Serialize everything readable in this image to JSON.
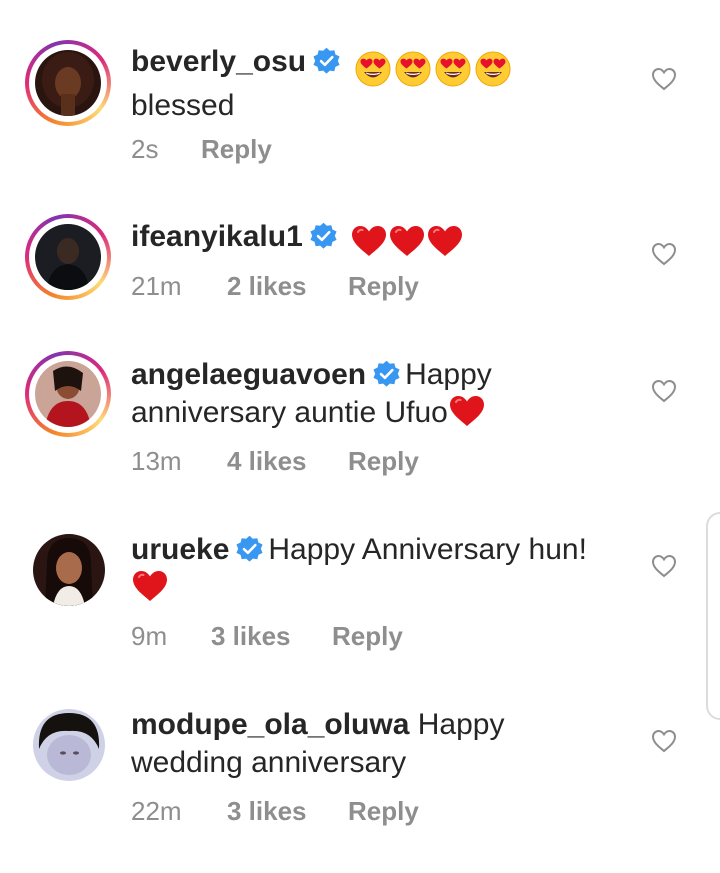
{
  "colors": {
    "text": "#262626",
    "meta": "#8e8e8e",
    "verified_badge": "#3897f0",
    "heart_red": "#e0151b"
  },
  "icons": {
    "verified": "verified-badge-icon",
    "like": "heart-outline-icon",
    "heart_eyes": "heart-eyes-emoji",
    "red_heart": "red-heart-emoji"
  },
  "comments": [
    {
      "username": "beverly_osu",
      "text": "blessed",
      "time": "2s",
      "likes": "",
      "reply": "Reply"
    },
    {
      "username": "ifeanyikalu1",
      "text": "",
      "time": "21m",
      "likes": "2 likes",
      "reply": "Reply"
    },
    {
      "username": "angelaeguavoen",
      "text_line1": "Happy",
      "text_line2": "anniversary auntie Ufuo",
      "time": "13m",
      "likes": "4 likes",
      "reply": "Reply"
    },
    {
      "username": "urueke",
      "text": "Happy Anniversary hun!",
      "time": "9m",
      "likes": "3 likes",
      "reply": "Reply"
    },
    {
      "username": "modupe_ola_oluwa",
      "text_line1": "Happy",
      "text_line2": "wedding anniversary",
      "time": "22m",
      "likes": "3 likes",
      "reply": "Reply"
    }
  ]
}
